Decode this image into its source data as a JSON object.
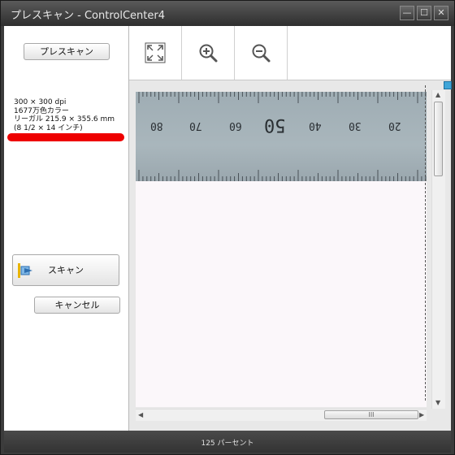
{
  "window": {
    "title": "プレスキャン - ControlCenter4",
    "minimize_glyph": "—",
    "maximize_glyph": "☐",
    "close_glyph": "✕"
  },
  "left": {
    "prescan_label": "プレスキャン",
    "info_lines": [
      "300 × 300 dpi",
      "1677万色カラー",
      "リーガル 215.9 × 355.6 mm",
      "(8 1/2 × 14 インチ)"
    ],
    "scan_label": "スキャン",
    "cancel_label": "キャンセル"
  },
  "toolbar": {
    "icons": [
      "fit-to-window-icon",
      "zoom-in-icon",
      "zoom-out-icon"
    ]
  },
  "preview": {
    "ruler_labels": [
      "80",
      "70",
      "60",
      "50",
      "40",
      "30",
      "20"
    ],
    "hscroll_grip": "III"
  },
  "status": {
    "zoom_text": "125 パーセント"
  },
  "colors": {
    "titlebar": "#3a3a3a",
    "highlight_red": "#ee0000",
    "ruler": "#a3b0b7"
  }
}
